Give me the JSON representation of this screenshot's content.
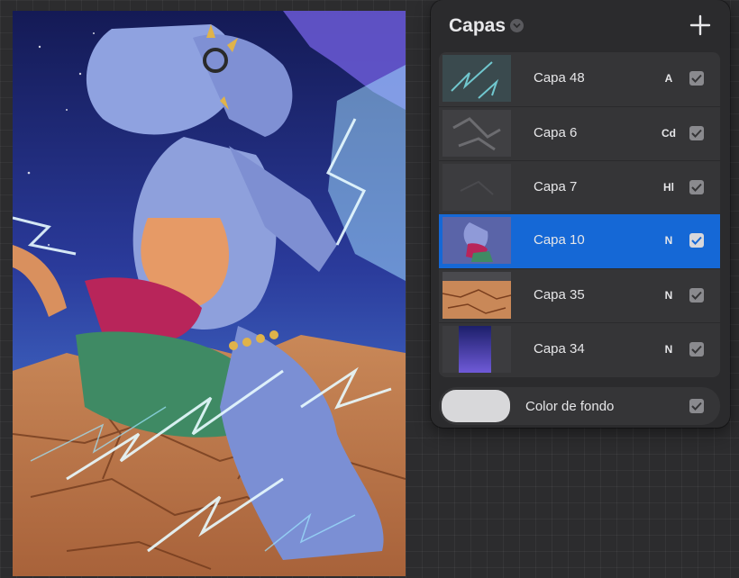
{
  "panel": {
    "title": "Capas",
    "add_icon": "plus-icon",
    "chevron_icon": "chevron-down-icon"
  },
  "layers": [
    {
      "name": "Capa 48",
      "blend": "A",
      "visible": true,
      "selected": false
    },
    {
      "name": "Capa 6",
      "blend": "Cd",
      "visible": true,
      "selected": false
    },
    {
      "name": "Capa 7",
      "blend": "Hl",
      "visible": true,
      "selected": false
    },
    {
      "name": "Capa 10",
      "blend": "N",
      "visible": true,
      "selected": true
    },
    {
      "name": "Capa 35",
      "blend": "N",
      "visible": true,
      "selected": false
    },
    {
      "name": "Capa 34",
      "blend": "N",
      "visible": true,
      "selected": false
    }
  ],
  "background": {
    "label": "Color de fondo",
    "visible": true,
    "color": "#d8d8da"
  },
  "colors": {
    "accent": "#1568d6",
    "panel": "#2b2b2d",
    "row": "#353537"
  }
}
